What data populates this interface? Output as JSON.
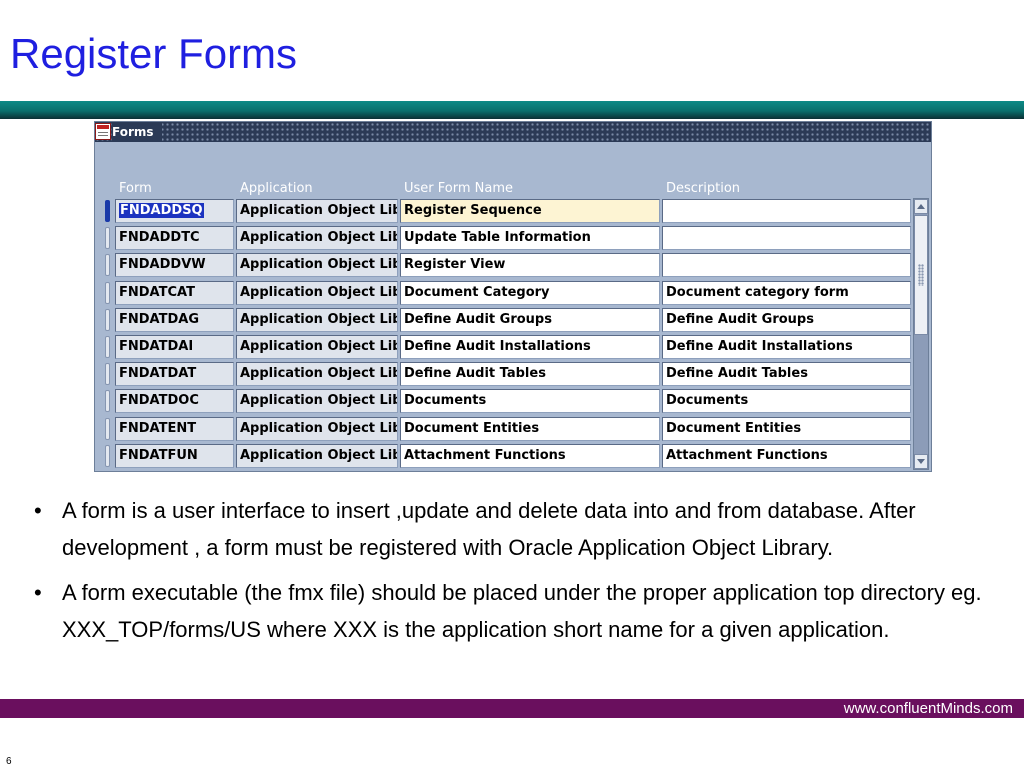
{
  "slide": {
    "title": "Register Forms",
    "footer_url": "www.confluentMinds.com",
    "page_number": "6"
  },
  "window": {
    "title": "Forms",
    "columns": {
      "form": "Form",
      "application": "Application",
      "user_form_name": "User Form Name",
      "description": "Description"
    },
    "rows": [
      {
        "form": "FNDADDSQ",
        "application": "Application Object Library",
        "user_form_name": "Register Sequence",
        "description": ""
      },
      {
        "form": "FNDADDTC",
        "application": "Application Object Library",
        "user_form_name": "Update Table Information",
        "description": ""
      },
      {
        "form": "FNDADDVW",
        "application": "Application Object Library",
        "user_form_name": "Register View",
        "description": ""
      },
      {
        "form": "FNDATCAT",
        "application": "Application Object Library",
        "user_form_name": "Document Category",
        "description": "Document category form"
      },
      {
        "form": "FNDATDAG",
        "application": "Application Object Library",
        "user_form_name": "Define Audit Groups",
        "description": "Define Audit Groups"
      },
      {
        "form": "FNDATDAI",
        "application": "Application Object Library",
        "user_form_name": "Define Audit Installations",
        "description": "Define Audit Installations"
      },
      {
        "form": "FNDATDAT",
        "application": "Application Object Library",
        "user_form_name": "Define Audit Tables",
        "description": "Define Audit Tables"
      },
      {
        "form": "FNDATDOC",
        "application": "Application Object Library",
        "user_form_name": "Documents",
        "description": "Documents"
      },
      {
        "form": "FNDATENT",
        "application": "Application Object Library",
        "user_form_name": "Document Entities",
        "description": "Document Entities"
      },
      {
        "form": "FNDATFUN",
        "application": "Application Object Library",
        "user_form_name": "Attachment Functions",
        "description": "Attachment Functions"
      }
    ]
  },
  "bullets": [
    " A form is a user interface to insert ,update and delete data into and from database. After development , a form must be registered with Oracle Application Object Library.",
    " A form executable (the fmx file) should be placed under the proper application top directory eg. XXX_TOP/forms/US where XXX is the application short name for a given application."
  ],
  "colors": {
    "title": "#1f1fe0",
    "top_band": "#0a6f6c",
    "bottom_band": "#6a0f5e",
    "window_bg": "#a8b8d0",
    "focused_cell": "#fdf4d3",
    "selection": "#1c33c0"
  }
}
